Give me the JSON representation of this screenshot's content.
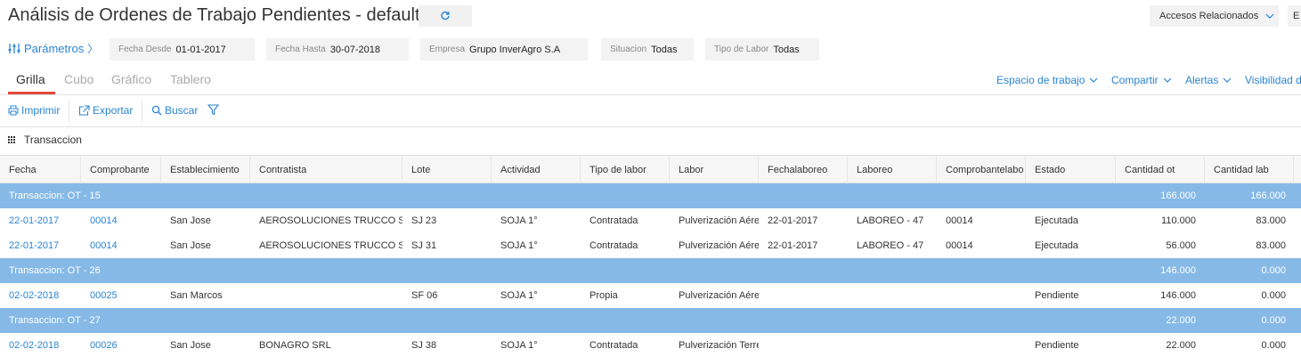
{
  "header": {
    "title": "Análisis de Ordenes de Trabajo Pendientes - default",
    "accesos_label": "Accesos Relacionados",
    "more_label": "E"
  },
  "params": {
    "link_label": "Parámetros",
    "chips": [
      {
        "label": "Fecha Desde",
        "value": "01-01-2017"
      },
      {
        "label": "Fecha Hasta",
        "value": "30-07-2018"
      },
      {
        "label": "Empresa",
        "value": "Grupo InverAgro S.A"
      },
      {
        "label": "Situacion",
        "value": "Todas"
      },
      {
        "label": "Tipo de Labor",
        "value": "Todas"
      }
    ]
  },
  "tabs": [
    {
      "label": "Grilla",
      "active": true
    },
    {
      "label": "Cubo",
      "active": false
    },
    {
      "label": "Gráfico",
      "active": false
    },
    {
      "label": "Tablero",
      "active": false
    }
  ],
  "right_menu": [
    {
      "label": "Espacio de trabajo"
    },
    {
      "label": "Compartir"
    },
    {
      "label": "Alertas"
    },
    {
      "label": "Visibilidad d"
    }
  ],
  "toolbar": {
    "print_label": "Imprimir",
    "export_label": "Exportar",
    "search_label": "Buscar"
  },
  "grid": {
    "group_by_label": "Transaccion",
    "columns": [
      "Fecha",
      "Comprobante",
      "Establecimiento",
      "Contratista",
      "Lote",
      "Actividad",
      "Tipo de labor",
      "Labor",
      "Fechalaboreo",
      "Laboreo",
      "Comprobantelabo",
      "Estado",
      "Cantidad ot",
      "Cantidad lab"
    ],
    "groups": [
      {
        "label": "Transaccion: OT - 15",
        "cantidad_ot": "166.000",
        "cantidad_lab": "166.000",
        "rows": [
          {
            "fecha": "22-01-2017",
            "comprobante": "00014",
            "establecimiento": "San Jose",
            "contratista": "AEROSOLUCIONES TRUCCO S.A.",
            "lote": "SJ 23",
            "actividad": "SOJA 1°",
            "tipo_labor": "Contratada",
            "labor": "Pulverización Aérea",
            "fechalaboreo": "22-01-2017",
            "laboreo": "LABOREO - 47",
            "comprobantelabo": "00014",
            "estado": "Ejecutada",
            "cantidad_ot": "110.000",
            "cantidad_lab": "83.000"
          },
          {
            "fecha": "22-01-2017",
            "comprobante": "00014",
            "establecimiento": "San Jose",
            "contratista": "AEROSOLUCIONES TRUCCO S.A.",
            "lote": "SJ 31",
            "actividad": "SOJA 1°",
            "tipo_labor": "Contratada",
            "labor": "Pulverización Aérea",
            "fechalaboreo": "22-01-2017",
            "laboreo": "LABOREO - 47",
            "comprobantelabo": "00014",
            "estado": "Ejecutada",
            "cantidad_ot": "56.000",
            "cantidad_lab": "83.000"
          }
        ]
      },
      {
        "label": "Transaccion: OT - 26",
        "cantidad_ot": "146.000",
        "cantidad_lab": "0.000",
        "rows": [
          {
            "fecha": "02-02-2018",
            "comprobante": "00025",
            "establecimiento": "San Marcos",
            "contratista": "",
            "lote": "SF 06",
            "actividad": "SOJA 1°",
            "tipo_labor": "Propia",
            "labor": "Pulverización Aérea",
            "fechalaboreo": "",
            "laboreo": "",
            "comprobantelabo": "",
            "estado": "Pendiente",
            "cantidad_ot": "146.000",
            "cantidad_lab": "0.000"
          }
        ]
      },
      {
        "label": "Transaccion: OT - 27",
        "cantidad_ot": "22.000",
        "cantidad_lab": "0.000",
        "rows": [
          {
            "fecha": "02-02-2018",
            "comprobante": "00026",
            "establecimiento": "San Jose",
            "contratista": "BONAGRO SRL",
            "lote": "SJ 38",
            "actividad": "SOJA 1°",
            "tipo_labor": "Contratada",
            "labor": "Pulverización Terrestre",
            "fechalaboreo": "",
            "laboreo": "",
            "comprobantelabo": "",
            "estado": "Pendiente",
            "cantidad_ot": "22.000",
            "cantidad_lab": "0.000"
          }
        ]
      }
    ]
  },
  "colors": {
    "accent": "#2a84d2",
    "tab_underline": "#e04a3a",
    "group_row": "#86b9e6"
  }
}
